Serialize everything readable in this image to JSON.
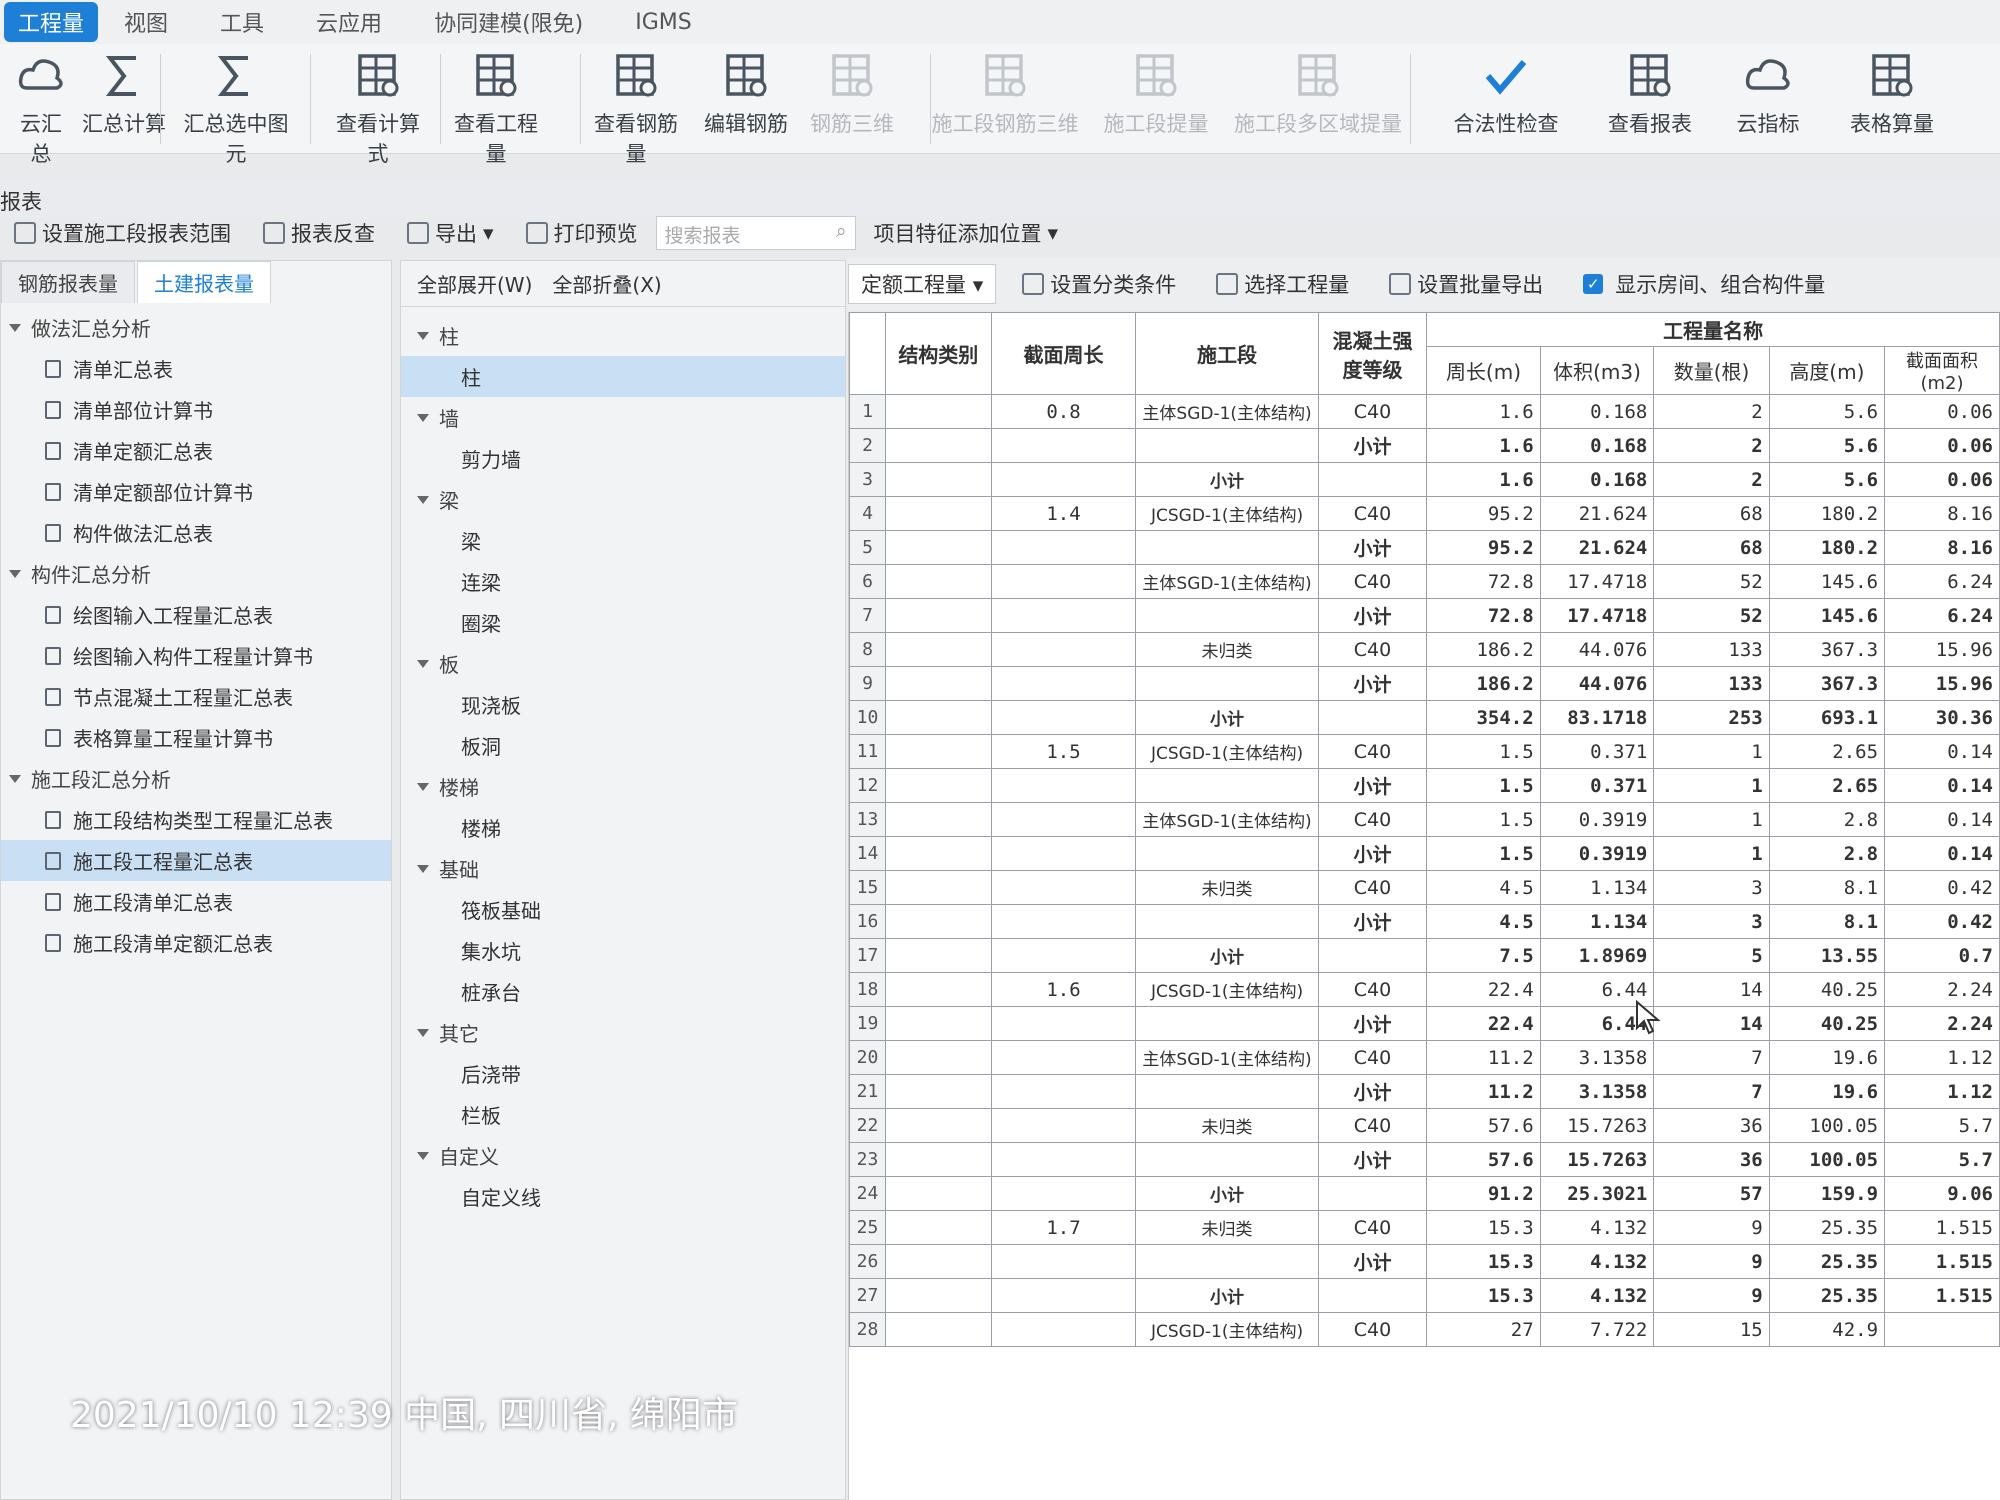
{
  "menu": [
    "工程量",
    "视图",
    "工具",
    "云应用",
    "协同建模(限免)",
    "IGMS"
  ],
  "ribbon": [
    {
      "label": "云汇总",
      "icon": "cloud-sigma-icon",
      "enabled": true
    },
    {
      "label": "汇总计算",
      "icon": "sigma-icon",
      "enabled": true
    },
    {
      "label": "汇总选中图元",
      "icon": "sigma-select-icon",
      "enabled": true
    },
    {
      "label": "查看计算式",
      "icon": "formula-view-icon",
      "enabled": true
    },
    {
      "label": "查看工程量",
      "icon": "quantity-view-icon",
      "enabled": true
    },
    {
      "label": "查看钢筋量",
      "icon": "rebar-view-icon",
      "enabled": true
    },
    {
      "label": "编辑钢筋",
      "icon": "rebar-edit-icon",
      "enabled": true
    },
    {
      "label": "钢筋三维",
      "icon": "rebar-3d-icon",
      "enabled": false
    },
    {
      "label": "施工段钢筋三维",
      "icon": "segment-rebar-3d-icon",
      "enabled": false
    },
    {
      "label": "施工段提量",
      "icon": "segment-extract-icon",
      "enabled": false
    },
    {
      "label": "施工段多区域提量",
      "icon": "segment-multi-extract-icon",
      "enabled": false
    },
    {
      "label": "合法性检查",
      "icon": "check-icon",
      "enabled": true
    },
    {
      "label": "查看报表",
      "icon": "report-view-icon",
      "enabled": true
    },
    {
      "label": "云指标",
      "icon": "cloud-index-icon",
      "enabled": true
    },
    {
      "label": "表格算量",
      "icon": "table-calc-icon",
      "enabled": true
    }
  ],
  "title": "报表",
  "toolbar": {
    "set_range": "设置施工段报表范围",
    "reverse": "报表反查",
    "export": "导出",
    "print": "打印预览",
    "search_placeholder": "搜索报表",
    "feature_pos": "项目特征添加位置"
  },
  "left_tabs": [
    "钢筋报表量",
    "土建报表量"
  ],
  "left_tree": [
    {
      "type": "group",
      "label": "做法汇总分析"
    },
    {
      "type": "leaf",
      "label": "清单汇总表"
    },
    {
      "type": "leaf",
      "label": "清单部位计算书"
    },
    {
      "type": "leaf",
      "label": "清单定额汇总表"
    },
    {
      "type": "leaf",
      "label": "清单定额部位计算书"
    },
    {
      "type": "leaf",
      "label": "构件做法汇总表"
    },
    {
      "type": "group",
      "label": "构件汇总分析"
    },
    {
      "type": "leaf",
      "label": "绘图输入工程量汇总表"
    },
    {
      "type": "leaf",
      "label": "绘图输入构件工程量计算书"
    },
    {
      "type": "leaf",
      "label": "节点混凝土工程量汇总表"
    },
    {
      "type": "leaf",
      "label": "表格算量工程量计算书"
    },
    {
      "type": "group",
      "label": "施工段汇总分析"
    },
    {
      "type": "leaf",
      "label": "施工段结构类型工程量汇总表"
    },
    {
      "type": "leaf",
      "label": "施工段工程量汇总表",
      "selected": true
    },
    {
      "type": "leaf",
      "label": "施工段清单汇总表"
    },
    {
      "type": "leaf",
      "label": "施工段清单定额汇总表"
    }
  ],
  "mid_toolbar": {
    "expand": "全部展开(W)",
    "collapse": "全部折叠(X)"
  },
  "mid_tree": [
    {
      "type": "group",
      "label": "柱"
    },
    {
      "type": "leaf",
      "label": "柱",
      "selected": true
    },
    {
      "type": "group",
      "label": "墙"
    },
    {
      "type": "leaf",
      "label": "剪力墙"
    },
    {
      "type": "group",
      "label": "梁"
    },
    {
      "type": "leaf",
      "label": "梁"
    },
    {
      "type": "leaf",
      "label": "连梁"
    },
    {
      "type": "leaf",
      "label": "圈梁"
    },
    {
      "type": "group",
      "label": "板"
    },
    {
      "type": "leaf",
      "label": "现浇板"
    },
    {
      "type": "leaf",
      "label": "板洞"
    },
    {
      "type": "group",
      "label": "楼梯"
    },
    {
      "type": "leaf",
      "label": "楼梯"
    },
    {
      "type": "group",
      "label": "基础"
    },
    {
      "type": "leaf",
      "label": "筏板基础"
    },
    {
      "type": "leaf",
      "label": "集水坑"
    },
    {
      "type": "leaf",
      "label": "桩承台"
    },
    {
      "type": "group",
      "label": "其它"
    },
    {
      "type": "leaf",
      "label": "后浇带"
    },
    {
      "type": "leaf",
      "label": "栏板"
    },
    {
      "type": "group",
      "label": "自定义"
    },
    {
      "type": "leaf",
      "label": "自定义线"
    }
  ],
  "grid_toolbar": {
    "quota": "定额工程量",
    "classify": "设置分类条件",
    "select": "选择工程量",
    "batch": "设置批量导出",
    "show_room": "显示房间、组合构件量"
  },
  "table": {
    "group_header": "工程量名称",
    "headers": [
      "结构类别",
      "截面周长",
      "施工段",
      "混凝土强度等级",
      "周长(m)",
      "体积(m3)",
      "数量(根)",
      "高度(m)",
      "截面面积(m2)"
    ],
    "rows": [
      [
        "1",
        "",
        "0.8",
        "主体SGD-1(主体结构)",
        "C40",
        "1.6",
        "0.168",
        "2",
        "5.6",
        "0.06"
      ],
      [
        "2",
        "",
        "",
        "",
        "小计",
        "1.6",
        "0.168",
        "2",
        "5.6",
        "0.06"
      ],
      [
        "3",
        "",
        "",
        "小计",
        "",
        "1.6",
        "0.168",
        "2",
        "5.6",
        "0.06"
      ],
      [
        "4",
        "",
        "1.4",
        "JCSGD-1(主体结构)",
        "C40",
        "95.2",
        "21.624",
        "68",
        "180.2",
        "8.16"
      ],
      [
        "5",
        "",
        "",
        "",
        "小计",
        "95.2",
        "21.624",
        "68",
        "180.2",
        "8.16"
      ],
      [
        "6",
        "",
        "",
        "主体SGD-1(主体结构)",
        "C40",
        "72.8",
        "17.4718",
        "52",
        "145.6",
        "6.24"
      ],
      [
        "7",
        "",
        "",
        "",
        "小计",
        "72.8",
        "17.4718",
        "52",
        "145.6",
        "6.24"
      ],
      [
        "8",
        "",
        "",
        "未归类",
        "C40",
        "186.2",
        "44.076",
        "133",
        "367.3",
        "15.96"
      ],
      [
        "9",
        "",
        "",
        "",
        "小计",
        "186.2",
        "44.076",
        "133",
        "367.3",
        "15.96"
      ],
      [
        "10",
        "",
        "",
        "小计",
        "",
        "354.2",
        "83.1718",
        "253",
        "693.1",
        "30.36"
      ],
      [
        "11",
        "",
        "1.5",
        "JCSGD-1(主体结构)",
        "C40",
        "1.5",
        "0.371",
        "1",
        "2.65",
        "0.14"
      ],
      [
        "12",
        "",
        "",
        "",
        "小计",
        "1.5",
        "0.371",
        "1",
        "2.65",
        "0.14"
      ],
      [
        "13",
        "",
        "",
        "主体SGD-1(主体结构)",
        "C40",
        "1.5",
        "0.3919",
        "1",
        "2.8",
        "0.14"
      ],
      [
        "14",
        "",
        "",
        "",
        "小计",
        "1.5",
        "0.3919",
        "1",
        "2.8",
        "0.14"
      ],
      [
        "15",
        "",
        "",
        "未归类",
        "C40",
        "4.5",
        "1.134",
        "3",
        "8.1",
        "0.42"
      ],
      [
        "16",
        "",
        "",
        "",
        "小计",
        "4.5",
        "1.134",
        "3",
        "8.1",
        "0.42"
      ],
      [
        "17",
        "",
        "",
        "小计",
        "",
        "7.5",
        "1.8969",
        "5",
        "13.55",
        "0.7"
      ],
      [
        "18",
        "",
        "1.6",
        "JCSGD-1(主体结构)",
        "C40",
        "22.4",
        "6.44",
        "14",
        "40.25",
        "2.24"
      ],
      [
        "19",
        "",
        "",
        "",
        "小计",
        "22.4",
        "6.44",
        "14",
        "40.25",
        "2.24"
      ],
      [
        "20",
        "",
        "",
        "主体SGD-1(主体结构)",
        "C40",
        "11.2",
        "3.1358",
        "7",
        "19.6",
        "1.12"
      ],
      [
        "21",
        "",
        "",
        "",
        "小计",
        "11.2",
        "3.1358",
        "7",
        "19.6",
        "1.12"
      ],
      [
        "22",
        "",
        "",
        "未归类",
        "C40",
        "57.6",
        "15.7263",
        "36",
        "100.05",
        "5.7"
      ],
      [
        "23",
        "",
        "",
        "",
        "小计",
        "57.6",
        "15.7263",
        "36",
        "100.05",
        "5.7"
      ],
      [
        "24",
        "",
        "",
        "小计",
        "",
        "91.2",
        "25.3021",
        "57",
        "159.9",
        "9.06"
      ],
      [
        "25",
        "",
        "1.7",
        "未归类",
        "C40",
        "15.3",
        "4.132",
        "9",
        "25.35",
        "1.515"
      ],
      [
        "26",
        "",
        "",
        "",
        "小计",
        "15.3",
        "4.132",
        "9",
        "25.35",
        "1.515"
      ],
      [
        "27",
        "",
        "",
        "小计",
        "",
        "15.3",
        "4.132",
        "9",
        "25.35",
        "1.515"
      ],
      [
        "28",
        "",
        "",
        "JCSGD-1(主体结构)",
        "C40",
        "27",
        "7.722",
        "15",
        "42.9",
        ""
      ]
    ]
  },
  "stamp": "2021/10/10 12:39  中国, 四川省, 绵阳市"
}
